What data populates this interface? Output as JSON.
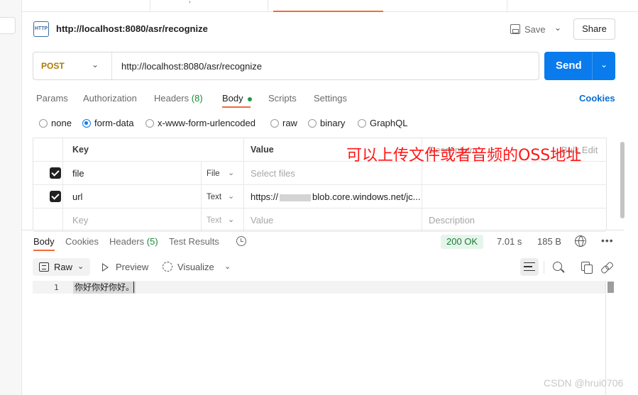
{
  "request": {
    "title": "http://localhost:8080/asr/recognize",
    "http_badge": "HTTP",
    "save_label": "Save",
    "share_label": "Share",
    "method": "POST",
    "url": "http://localhost:8080/asr/recognize",
    "send_label": "Send"
  },
  "request_tabs": {
    "params": "Params",
    "authorization": "Authorization",
    "headers": "Headers",
    "headers_count": "(8)",
    "body": "Body",
    "scripts": "Scripts",
    "settings": "Settings",
    "cookies": "Cookies"
  },
  "body_modes": [
    "none",
    "form-data",
    "x-www-form-urlencoded",
    "raw",
    "binary",
    "GraphQL"
  ],
  "body_mode_selected": "form-data",
  "params_table": {
    "headers": {
      "key": "Key",
      "value": "Value",
      "description": "Description",
      "bulk_edit": "Bulk Edit"
    },
    "rows": [
      {
        "key": "file",
        "type": "File",
        "value": "Select files",
        "checked": true
      },
      {
        "key": "url",
        "type": "Text",
        "value_prefix": "https://",
        "value_suffix": "blob.core.windows.net/jc...",
        "checked": true
      }
    ],
    "placeholder": {
      "key": "Key",
      "type": "Text",
      "value": "Value",
      "description": "Description"
    }
  },
  "annotation": "可以上传文件或者音频的OSS地址",
  "response": {
    "tabs": {
      "body": "Body",
      "cookies": "Cookies",
      "headers": "Headers",
      "headers_count": "(5)",
      "test_results": "Test Results"
    },
    "status": "200 OK",
    "time": "7.01 s",
    "size": "185 B",
    "format": "Raw",
    "preview": "Preview",
    "visualize": "Visualize",
    "lines": [
      {
        "number": "1",
        "text": "你好你好你好。"
      }
    ]
  },
  "colors": {
    "send": "#097bed",
    "accent_orange": "#f26b3a",
    "method_post": "#ad7a03",
    "status_ok": "#1a7a35",
    "annotation": "#ff1616"
  },
  "watermark": "CSDN @hrui0706"
}
